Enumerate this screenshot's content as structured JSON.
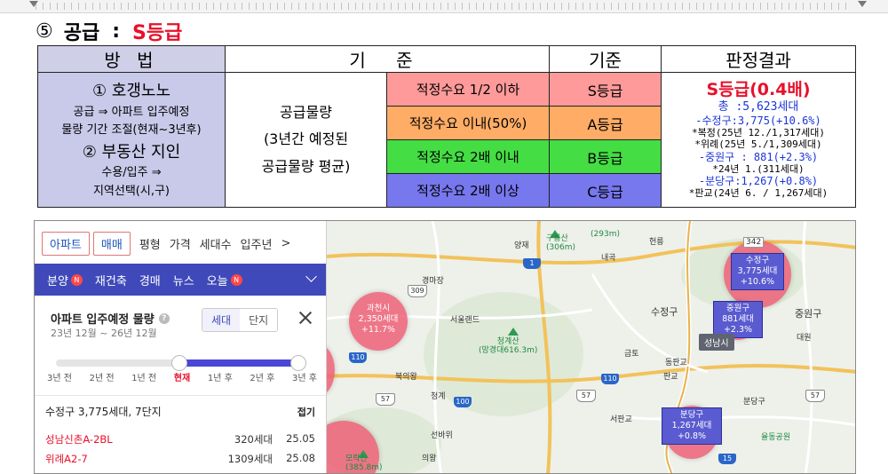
{
  "heading": {
    "number": "⑤",
    "title": "공급",
    "colon": ":",
    "grade": "S등급"
  },
  "table": {
    "headers": {
      "method": "방 법",
      "criteria": "기 준",
      "standard": "기준",
      "result": "판정결과"
    },
    "method": {
      "line1": "① 호갱노노",
      "line2": "공급 ⇒ 아파트 입주예정",
      "line3": "물량 기간 조절(현재~3년후)",
      "line4": "② 부동산 지인",
      "line5": "수용/입주 ⇒",
      "line6": "지역선택(시,구)"
    },
    "description": {
      "line1": "공급물량",
      "line2": "(3년간 예정된",
      "line3": "공급물량 평균)"
    },
    "rows": [
      {
        "condition": "적정수요 1/2 이하",
        "grade": "S등급",
        "color": "#ff9a9a"
      },
      {
        "condition": "적정수요 이내(50%)",
        "grade": "A등급",
        "color": "#ffad66"
      },
      {
        "condition": "적정수요 2배 이내",
        "grade": "B등급",
        "color": "#44dd44"
      },
      {
        "condition": "적정수요 2배 이상",
        "grade": "C등급",
        "color": "#7777ee"
      }
    ],
    "result": {
      "grade": "S등급(0.4배)",
      "total": "총 :5,623세대",
      "sujeong": "-수정구:3,775(+10.6%)",
      "sujeong_note1": "*복정(25년 12./1,317세대)",
      "sujeong_note2": "*위례(25년 5./1,309세대)",
      "jungwon": "-중원구 : 881(+2.3%)",
      "jungwon_note": "*24년 1.(311세대)",
      "bundang": "-분당구:1,267(+0.8%)",
      "bundang_note": "*판교(24년 6. / 1,267세대)"
    }
  },
  "app": {
    "tabs": [
      "아파트",
      "매매"
    ],
    "filters": [
      "평형",
      "가격",
      "세대수",
      "입주년"
    ],
    "filter_more": ">",
    "nav": [
      "분양",
      "재건축",
      "경매",
      "뉴스",
      "오늘"
    ],
    "nav_badge": "N",
    "panel_title": "아파트 입주예정 물량",
    "help": "?",
    "period": "23년 12월 ~ 26년 12월",
    "segments": [
      "세대",
      "단지"
    ],
    "slider_labels": [
      "3년 전",
      "2년 전",
      "1년 전",
      "현재",
      "1년 후",
      "2년 후",
      "3년 후"
    ],
    "slider_value": "현재~3년 후",
    "district_summary": "수정구 3,775세대, 7단지",
    "fold": "접기",
    "list": [
      {
        "name": "성남신촌A-2BL",
        "units": "320세대",
        "date": "25.05"
      },
      {
        "name": "위례A2-7",
        "units": "1309세대",
        "date": "25.08"
      }
    ]
  },
  "map": {
    "districts": [
      {
        "name": "수정구",
        "units": "3,775세대",
        "pct": "+10.6%"
      },
      {
        "name": "중원구",
        "units": "881세대",
        "pct": "+2.3%"
      },
      {
        "name": "분당구",
        "units": "1,267세대",
        "pct": "+0.8%"
      },
      {
        "name": "과천시",
        "units": "2,350세대",
        "pct": "+11.7%"
      }
    ],
    "station": "성남시",
    "labels": [
      "양재",
      "구룡산\n(306m)",
      "(293m)",
      "헌릉",
      "내곡",
      "342",
      "경마장",
      "서울랜드",
      "청계산\n(망경대616.3m)",
      "수정구",
      "중원구",
      "대원",
      "금토",
      "동판교",
      "판교",
      "분당구",
      "서판교",
      "율동공원",
      "북의왕",
      "청계",
      "모락산\n(385.8m)",
      "선바위",
      "의왕"
    ],
    "shields": [
      "1",
      "309",
      "110",
      "100",
      "57",
      "110",
      "57",
      "57",
      "15"
    ]
  }
}
